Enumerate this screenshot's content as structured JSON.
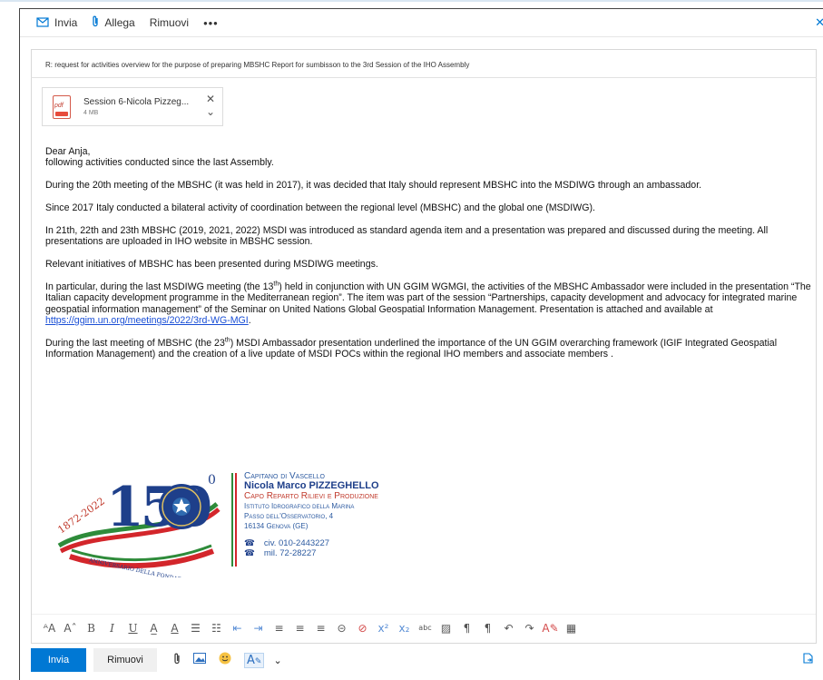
{
  "toolbar": {
    "send_label": "Invia",
    "attach_label": "Allega",
    "discard_label": "Rimuovi",
    "more_label": "•••",
    "close_label": "✕"
  },
  "subject": {
    "text": "R: request for activities overview for the purpose of preparing MBSHC Report for sumbisson to the 3rd Session of the IHO Assembly"
  },
  "attachment": {
    "icon_label": "pdf",
    "name": "Session 6-Nicola Pizzeg...",
    "size": "4 MB"
  },
  "body": {
    "greeting": "Dear Anja,",
    "intro": "following activities conducted since the last Assembly.",
    "p1": "During the 20th meeting of the MBSHC (it was held in 2017), it was decided that Italy should represent MBSHC into the MSDIWG through an ambassador.",
    "p2": "Since 2017 Italy conducted a bilateral activity of coordination between the regional level (MBSHC) and the global one (MSDIWG).",
    "p3": "In 21th, 22th and 23th MBSHC (2019, 2021, 2022) MSDI was introduced as standard agenda item and a presentation was prepared and discussed during the meeting. All presentations are uploaded in IHO website in MBSHC session.",
    "p4": "Relevant initiatives of MBSHC has been presented during MSDIWG meetings.",
    "p5_a": "In particular, during the last MSDIWG meeting (the 13",
    "p5_sup": "th",
    "p5_b": ") held in conjunction with UN GGIM WGMGI, the activities of the MBSHC Ambassador were included in the presentation “The Italian capacity development programme in the Mediterranean region”. The item was part of the session “Partnerships, capacity development and advocacy for integrated marine geospatial information management” of the Seminar on United Nations Global Geospatial Information Management. Presentation is attached and available at ",
    "p5_link": "https://ggim.un.org/meetings/2022/3rd-WG-MGI",
    "p5_c": ".",
    "p6_a": "During the last meeting of MBSHC (the 23",
    "p6_sup": "th",
    "p6_b": ") MSDI Ambassador presentation underlined the importance of the UN GGIM overarching framework (IGIF Integrated Geospatial Information Management) and the creation of a live update of MSDI POCs within the regional IHO members and associate members ."
  },
  "signature": {
    "logo_years": "1872-2022",
    "logo_number": "150",
    "logo_sup": "0",
    "logo_ribbon": "ANNIVERSARIO DELLA FONDAZIONE",
    "rank": "Capitano di Vascello",
    "name": "Nicola Marco PIZZEGHELLO",
    "role": "Capo Reparto Rilievi e Produzione",
    "inst1": "Istituto Idrografico della Marina",
    "inst2": "Passo dell'Osservatorio, 4",
    "inst3": "16134 Genova (GE)",
    "phone1": "civ. 010-2443227",
    "phone2": "mil. 72-28227"
  },
  "send_bar": {
    "send_label": "Invia",
    "discard_label": "Rimuovi"
  },
  "colors": {
    "accent": "#0078d4",
    "link": "#1a4fd6",
    "flag_green": "#2e8b3a",
    "flag_white": "#ffffff",
    "flag_red": "#d3262b"
  }
}
